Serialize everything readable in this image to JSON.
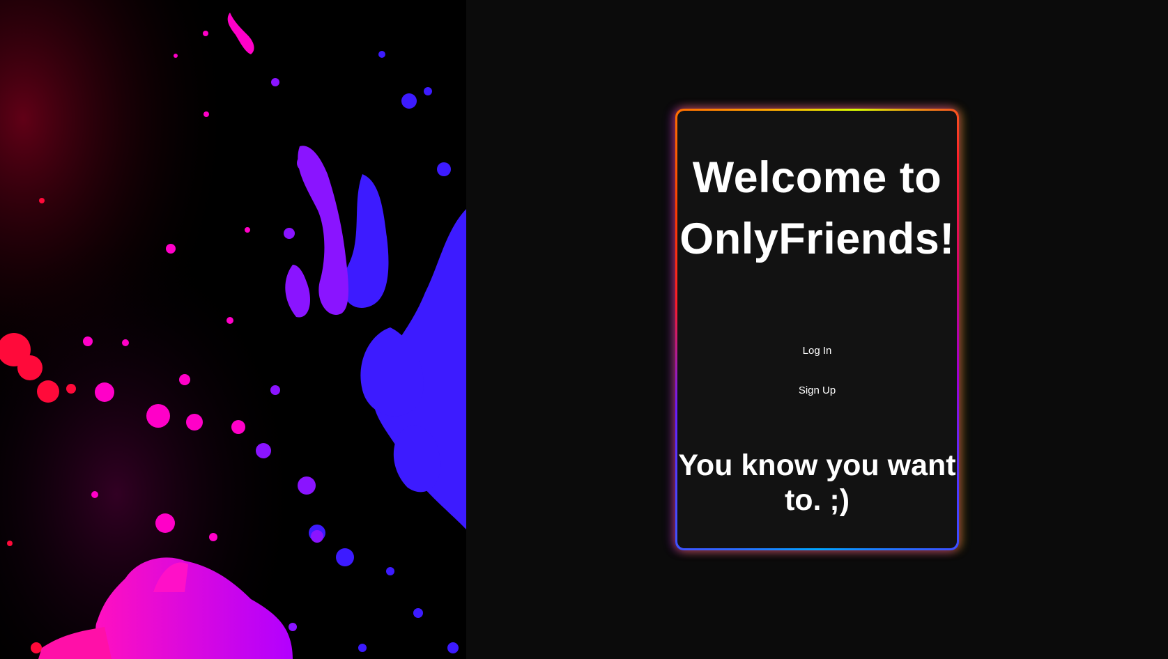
{
  "hero": {
    "art_name": "paint-splatter-art",
    "colors": [
      "#ff0a3a",
      "#ff00c8",
      "#b400ff",
      "#5a1bff",
      "#3d1bff"
    ]
  },
  "card": {
    "title": "Welcome to OnlyFriends!",
    "login_label": "Log In",
    "signup_label": "Sign Up",
    "tagline": "You know you want to. ;)",
    "glow_colors": [
      "#ff1a2a",
      "#d8ff00",
      "#9b00d8",
      "#2b6cff",
      "#ff3b00"
    ]
  },
  "colors": {
    "page_background": "#0b0b0b",
    "card_background": "#121212",
    "text": "#ffffff"
  }
}
